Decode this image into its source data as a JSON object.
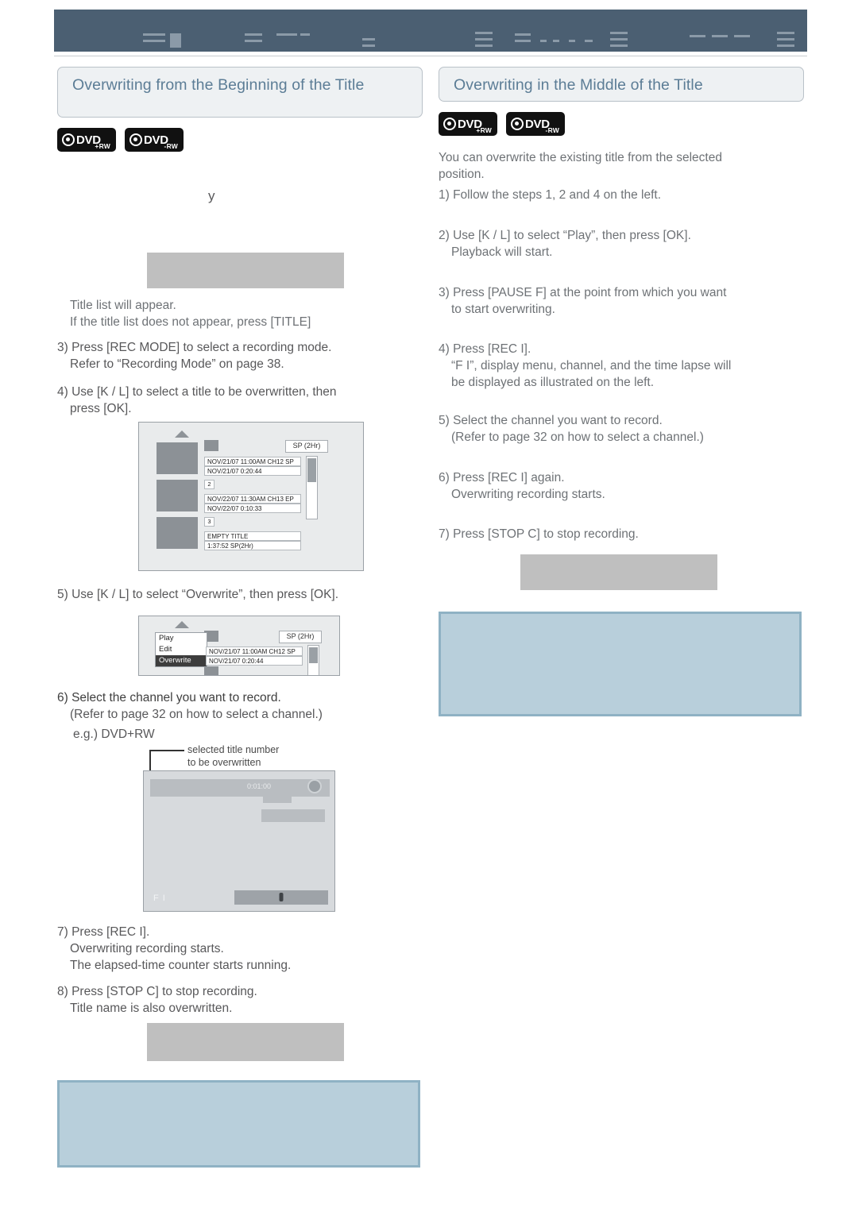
{
  "topbar": {
    "label": ""
  },
  "left": {
    "section_title": "Overwriting from the Beginning of the Title",
    "logos": [
      {
        "name": "dvd-plus-rw-logo",
        "text": "DVD",
        "sub": "+RW"
      },
      {
        "name": "dvd-minus-rw-logo",
        "text": "DVD",
        "sub": "-RW"
      }
    ],
    "stray_char": "y",
    "after_block_1": "Title list will appear.",
    "after_block_2": "If the title list does not appear, press [TITLE]",
    "step3": "3) Press [REC MODE] to select a recording mode.",
    "step3_ind": "Refer to “Recording Mode” on page 38.",
    "step4": "4) Use [K / L] to select a title to be overwritten, then",
    "step4_ind": "press [OK].",
    "step5": "5) Use [K / L] to select “Overwrite”, then press [OK].",
    "step6": "6) Select the channel you want to record.",
    "step6_ind": "(Refer to page 32 on how to select a channel.)",
    "eg": "e.g.) DVD+RW",
    "callout_line1": "selected title number",
    "callout_line2": "to be overwritten",
    "step7": "7) Press [REC I].",
    "step7_ind1": "Overwriting recording starts.",
    "step7_ind2": "The elapsed-time counter starts running.",
    "step8": "8) Press [STOP C] to stop recording.",
    "step8_ind": "Title name is also overwritten.",
    "titlelist": {
      "sp_label": "SP (2Hr)",
      "rows": [
        {
          "num": "",
          "line1": "NOV/21/07  11:00AM  CH12  SP",
          "line2": "NOV/21/07     0:20:44"
        },
        {
          "num": "2",
          "line1": "NOV/22/07  11:30AM  CH13  EP",
          "line2": "NOV/22/07     0:10:33"
        },
        {
          "num": "3",
          "line1": "EMPTY TITLE",
          "line2": "1:37:52  SP(2Hr)"
        }
      ]
    },
    "menulist": {
      "sp_label": "SP (2Hr)",
      "items": [
        "Play",
        "Edit",
        "Overwrite"
      ],
      "selected": "Overwrite",
      "rows": [
        {
          "line1": "NOV/21/07  11:00AM  CH12  SP",
          "line2": "NOV/21/07     0:20:44"
        }
      ]
    },
    "recscreen": {
      "time": "0:01:00",
      "fl": "F  I"
    }
  },
  "right": {
    "section_title": "Overwriting in the Middle of the Title",
    "logos": [
      {
        "name": "dvd-plus-rw-logo",
        "text": "DVD",
        "sub": "+RW"
      },
      {
        "name": "dvd-minus-rw-logo",
        "text": "DVD",
        "sub": "-RW"
      }
    ],
    "intro1": "You can overwrite the existing title from the selected",
    "intro2": "position.",
    "step1": "1) Follow the steps 1, 2 and 4 on the left.",
    "step2": "2) Use [K / L] to select “Play”, then press [OK].",
    "step2_ind": "Playback will start.",
    "step3": "3) Press [PAUSE F] at the point from which you want",
    "step3_ind": "to start overwriting.",
    "step4": "4) Press [REC I].",
    "step4_ind1": "“F I”, display menu, channel, and the time lapse will",
    "step4_ind2": "be displayed as illustrated on the left.",
    "step5": "5) Select the channel you want to record.",
    "step5_ind": "(Refer to page 32 on how to select a channel.)",
    "step6": "6) Press [REC I] again.",
    "step6_ind": "Overwriting recording starts.",
    "step7": "7) Press [STOP C] to stop recording."
  }
}
